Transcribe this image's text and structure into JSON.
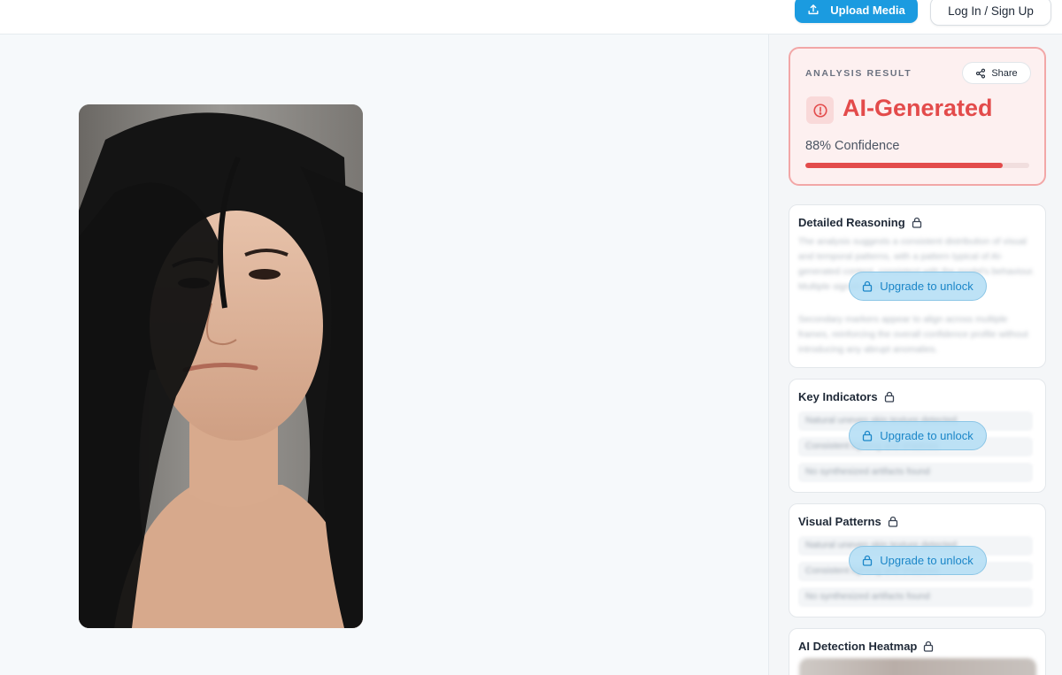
{
  "header": {
    "upload_label": "Upload Media",
    "login_label": "Log In / Sign Up"
  },
  "media": {
    "icon": "portrait-photo"
  },
  "result": {
    "label": "ANALYSIS RESULT",
    "share_label": "Share",
    "verdict": "AI-Generated",
    "confidence_text": "88% Confidence",
    "confidence_value": 88,
    "accent_color": "#e34b4b"
  },
  "sections": [
    {
      "title": "Detailed Reasoning",
      "upgrade_label": "Upgrade to unlock",
      "blurred_paragraphs": [
        "The analysis suggests a consistent distribution of visual and temporal patterns, with a pattern typical of AI-generated content, consistent with the model's behaviour. Multiple signals agree on this verdict.",
        "Secondary markers appear to align across multiple frames, reinforcing the overall confidence profile without introducing any abrupt anomalies."
      ]
    },
    {
      "title": "Key Indicators",
      "upgrade_label": "Upgrade to unlock",
      "blurred_rows": [
        "Natural uneven skin texture detected",
        "Consistent lighting and shadows",
        "No synthesized artifacts found"
      ]
    },
    {
      "title": "Visual Patterns",
      "upgrade_label": "Upgrade to unlock",
      "blurred_rows": [
        "Natural uneven skin texture detected",
        "Consistent lighting and shadows",
        "No synthesized artifacts found"
      ]
    },
    {
      "title": "AI Detection Heatmap"
    }
  ],
  "colors": {
    "brand": "#1b9be0",
    "danger": "#e34b4b",
    "upgrade_text": "#1b86c8"
  }
}
